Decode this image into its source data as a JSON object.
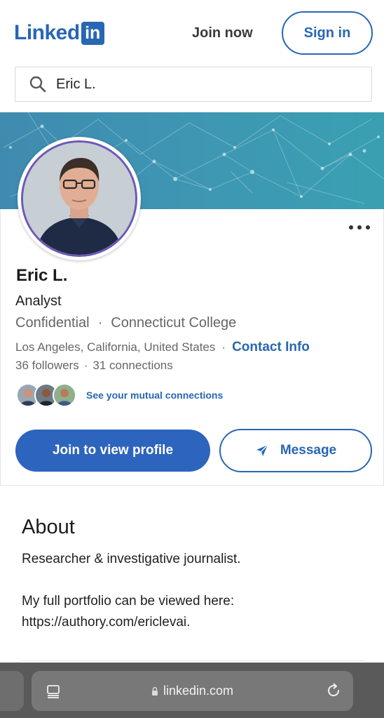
{
  "header": {
    "logo_text": "Linked",
    "logo_box": "in",
    "join_now": "Join now",
    "sign_in": "Sign in",
    "brand_color": "#2867b2"
  },
  "search": {
    "value": "Eric L.",
    "icon": "search-icon"
  },
  "profile": {
    "name": "Eric L.",
    "headline": "Analyst",
    "company": "Confidential",
    "school": "Connecticut College",
    "location": "Los Angeles, California, United States",
    "contact_info": "Contact Info",
    "followers": "36 followers",
    "connections": "31 connections",
    "mutual_connections": "See your mutual connections",
    "separator": "·",
    "more_icon": "more-options-icon"
  },
  "actions": {
    "join_to_view": "Join to view profile",
    "message": "Message",
    "message_icon": "send-icon"
  },
  "about": {
    "title": "About",
    "line1": "Researcher & investigative journalist.",
    "line2": "My full portfolio can be viewed here:",
    "line3": "https://authory.com/ericlevai."
  },
  "browser": {
    "url": "linkedin.com",
    "tabs_icon": "tabs-icon",
    "lock_icon": "lock-icon",
    "reload_icon": "reload-icon"
  }
}
